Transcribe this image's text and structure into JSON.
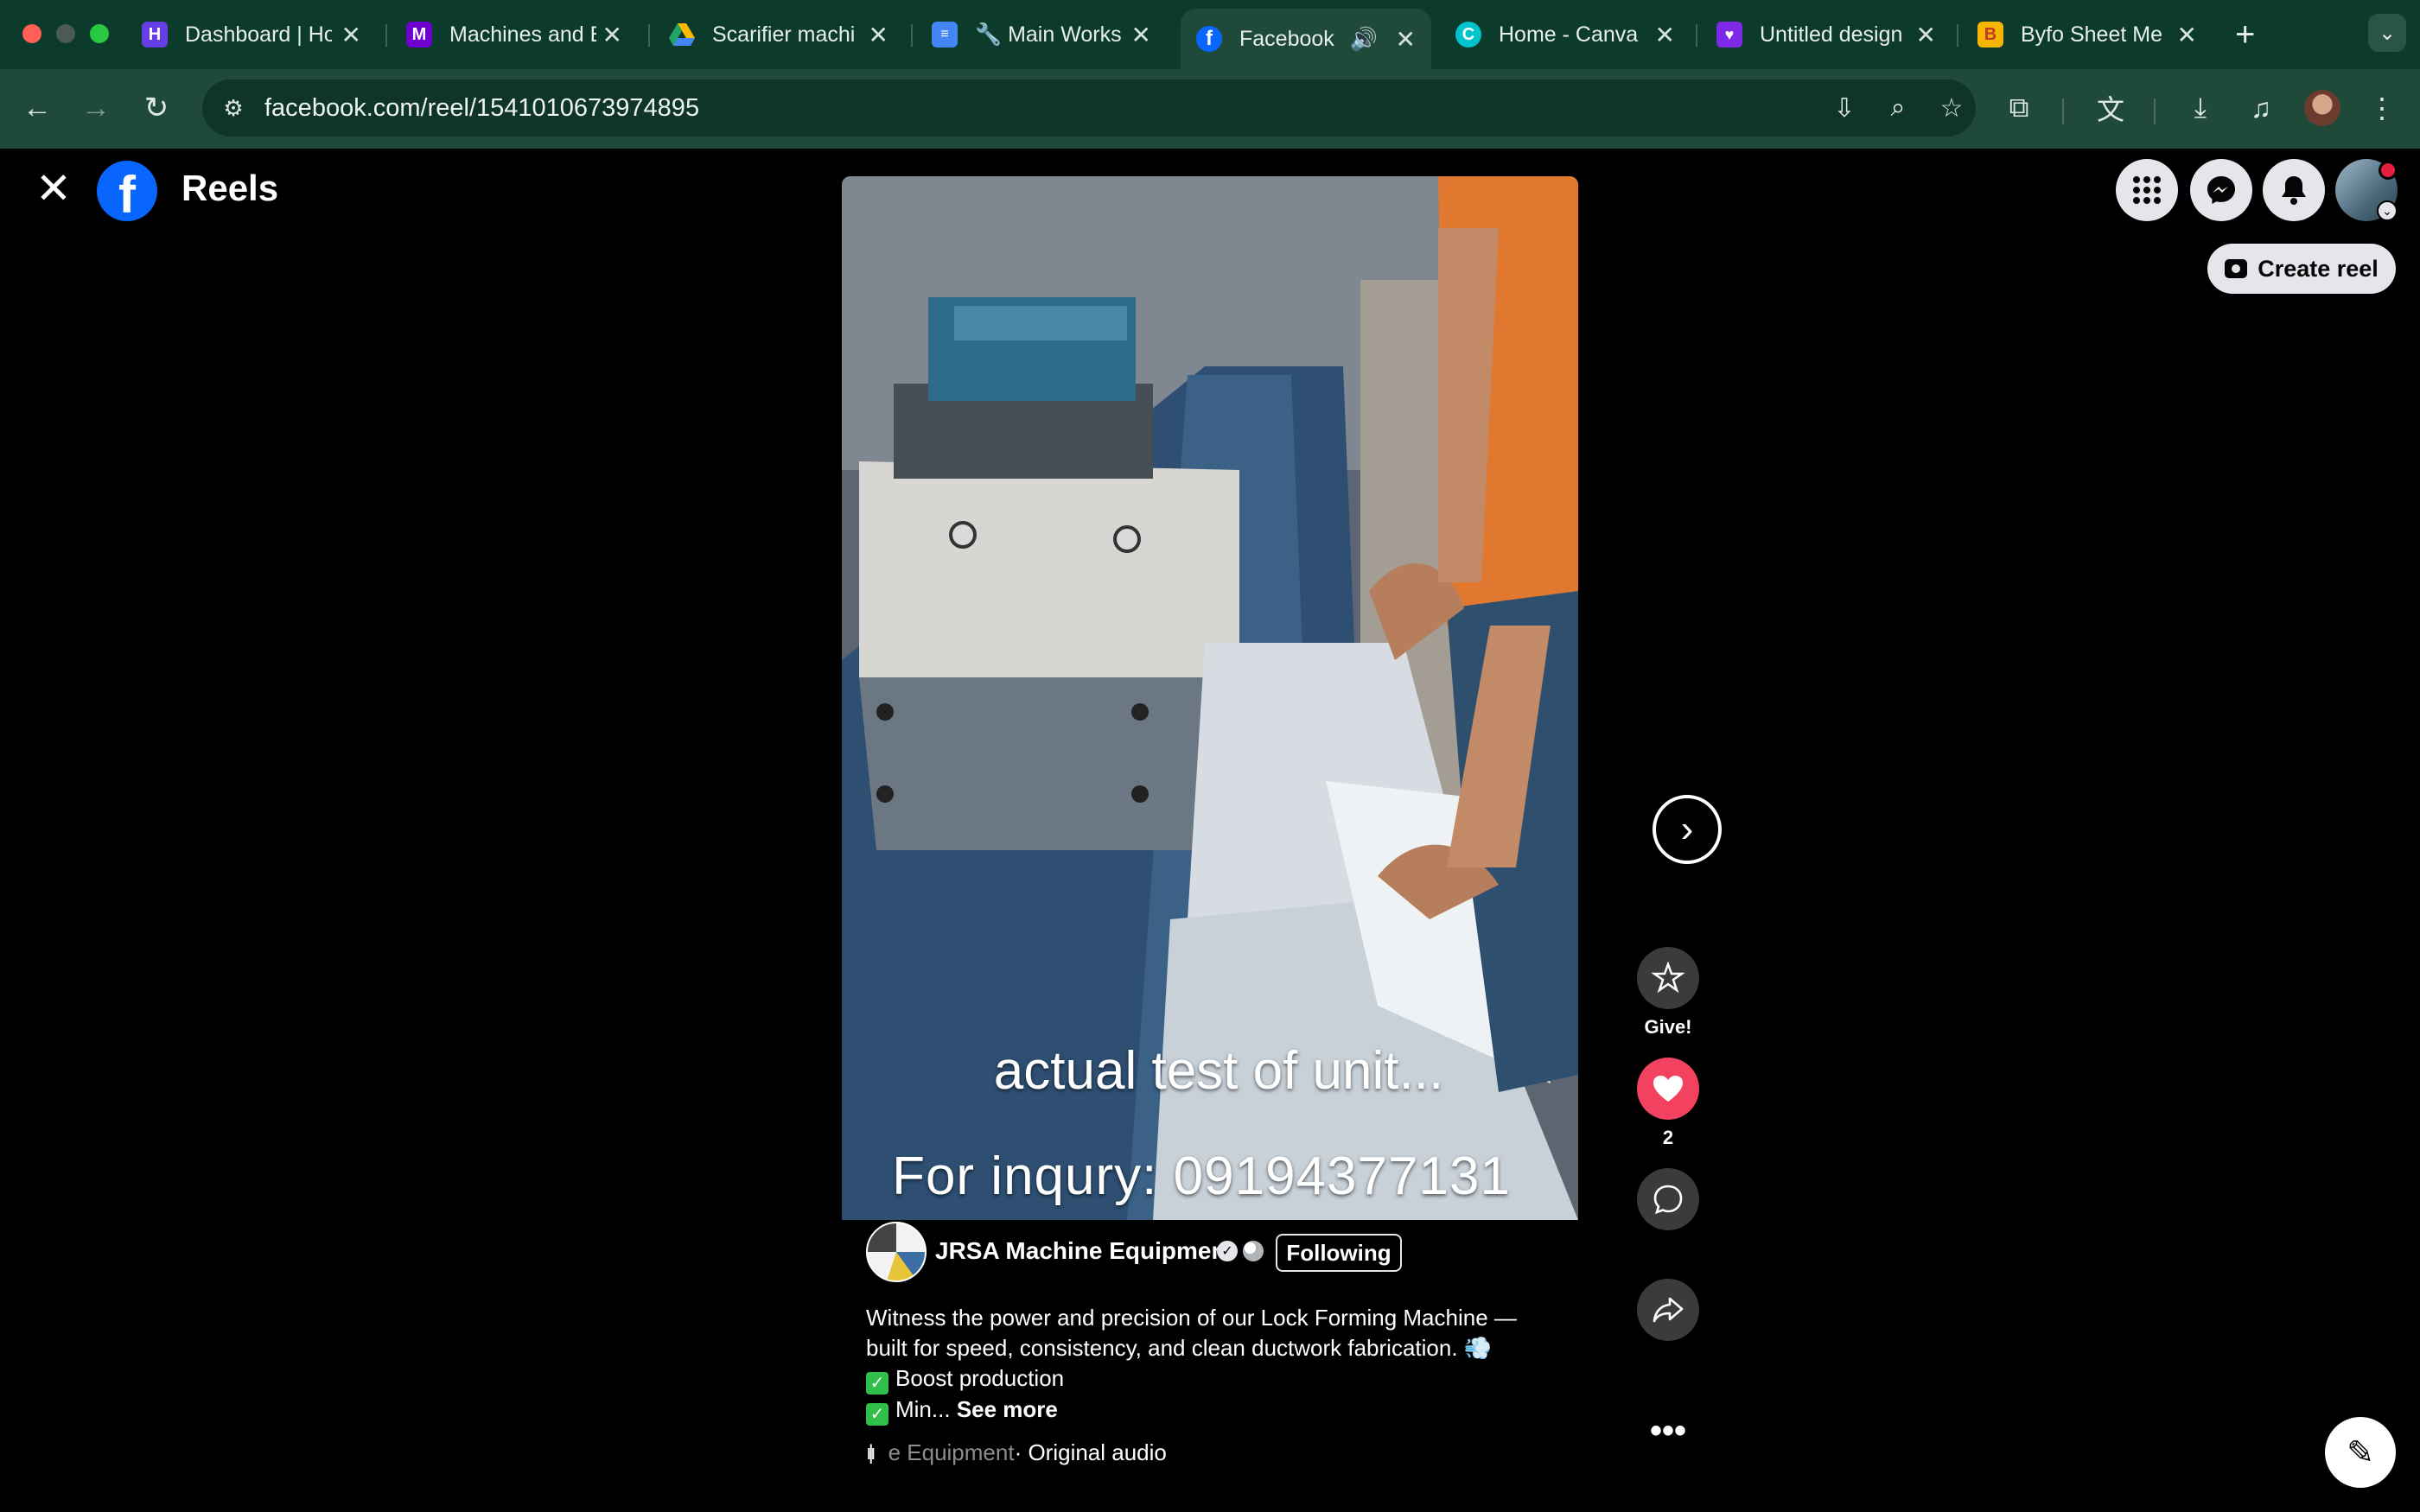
{
  "browser": {
    "tabs": [
      {
        "title": "Dashboard | Ho",
        "favicon": "hostinger-icon",
        "color": "#673de6"
      },
      {
        "title": "Machines and E",
        "favicon": "make-icon",
        "color": "#6d00cc"
      },
      {
        "title": "Scarifier machi",
        "favicon": "google-drive-icon",
        "color": "#1fa463"
      },
      {
        "title": "🔧 Main Works",
        "favicon": "google-docs-icon",
        "color": "#4285f4"
      },
      {
        "title": "Facebook",
        "favicon": "facebook-icon",
        "color": "#0866ff"
      },
      {
        "title": "Home - Canva",
        "favicon": "canva-icon",
        "color": "#00c4cc"
      },
      {
        "title": "Untitled design",
        "favicon": "heart-chat-icon",
        "color": "#7d2ae8"
      },
      {
        "title": "Byfo Sheet Me",
        "favicon": "byfo-icon",
        "color": "#f7b500"
      }
    ],
    "url": "facebook.com/reel/1541010673974895"
  },
  "header": {
    "title": "Reels",
    "create_reel_label": "Create reel"
  },
  "video": {
    "caption_line1": "actual test of unit...",
    "caption_line2": "For inqury: 09194377131"
  },
  "post": {
    "page_name": "JRSA Machine Equipment",
    "follow_state": "Following",
    "desc_line1": "Witness the power and precision of our Lock Forming Machine —",
    "desc_line2": "built for speed, consistency, and clean ductwork fabrication. 💨",
    "desc_line3": "Boost production",
    "desc_line4": "Min...",
    "see_more": "See more",
    "audio_faded": "e Equipment",
    "audio_text": " · Original audio"
  },
  "actions": {
    "give_label": "Give!",
    "like_count": "2"
  },
  "colors": {
    "tab_strip": "#0d3b2b",
    "toolbar": "#1f4a3a",
    "facebook_blue": "#0866ff",
    "like_red": "#f3425f"
  }
}
